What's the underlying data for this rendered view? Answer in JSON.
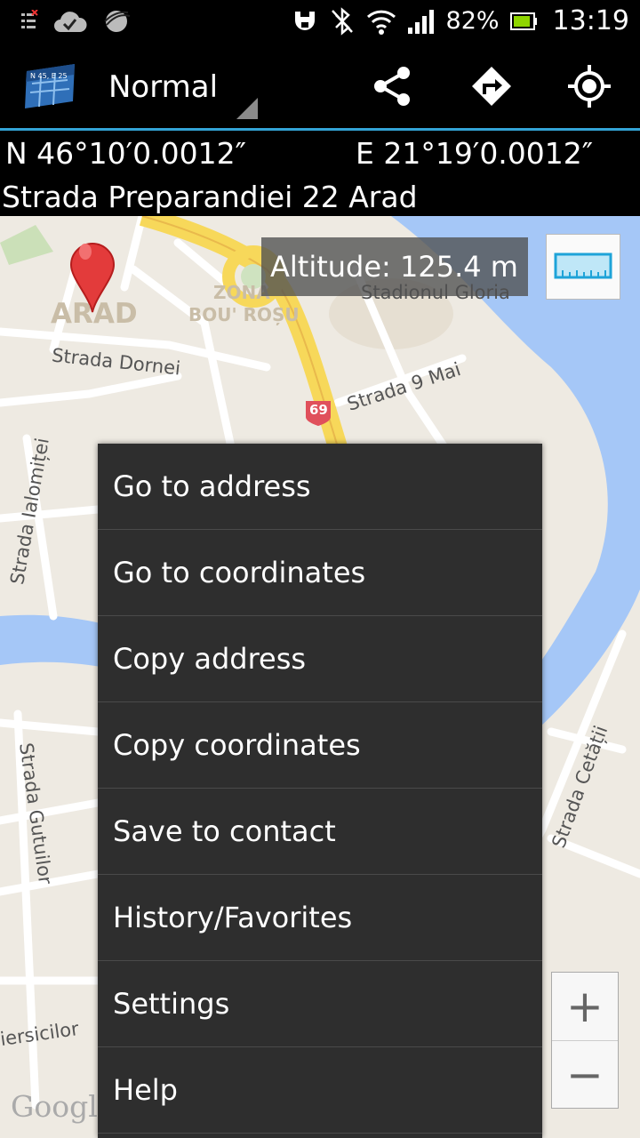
{
  "status_bar": {
    "battery_percent": "82%",
    "time": "13:19"
  },
  "action_bar": {
    "app_icon_label": "N 45, E 25",
    "map_mode": "Normal"
  },
  "location": {
    "latitude": "N 46°10′0.0012″",
    "longitude": "E 21°19′0.0012″",
    "address": "Strada Preparandiei 22 Arad"
  },
  "map": {
    "altitude": "Altitude:  125.4 m",
    "labels": {
      "city": "ARAD",
      "zona": "ZONA",
      "bou_rosu": "BOU' ROȘU",
      "stadion": "Stadionul Gloria",
      "strada_dornei": "Strada Dornei",
      "strada_9mai": "Strada 9 Mai",
      "route": "69",
      "strada_ialomitei": "Strada Ialomiței",
      "strada_gutuilor": "Strada Gutuilor",
      "strada_cetatii": "Strada Cetății",
      "iersicilor": "iersicilor",
      "google": "Google"
    },
    "zoom_in": "+",
    "zoom_out": "−"
  },
  "menu": {
    "items": [
      "Go to address",
      "Go to coordinates",
      "Copy address",
      "Copy coordinates",
      "Save to contact",
      "History/Favorites",
      "Settings",
      "Help"
    ]
  }
}
